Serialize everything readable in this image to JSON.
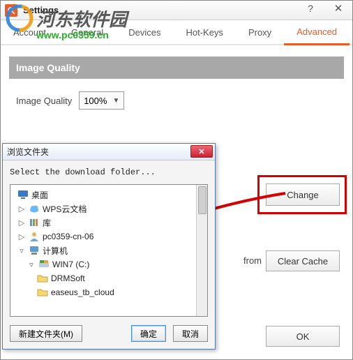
{
  "watermark": {
    "text": "河东软件园",
    "url": "www.pc0359.cn"
  },
  "titlebar": {
    "title": "Settings",
    "help": "?",
    "close": "✕"
  },
  "tabs": {
    "account": "Account",
    "general": "General",
    "devices": "Devices",
    "hotkeys": "Hot-Keys",
    "proxy": "Proxy",
    "advanced": "Advanced"
  },
  "imageQuality": {
    "header": "Image Quality",
    "label": "Image Quality",
    "value": "100%"
  },
  "buttons": {
    "change": "Change",
    "clearCache": "Clear Cache",
    "ok": "OK"
  },
  "fromText": "from",
  "browse": {
    "title": "浏览文件夹",
    "instruction": "Select the download folder...",
    "close": "✕",
    "newFolder": "新建文件夹(M)",
    "ok": "确定",
    "cancel": "取消",
    "tree": {
      "desktop": "桌面",
      "wps": "WPS云文档",
      "libraries": "库",
      "pc": "pc0359-cn-06",
      "computer": "计算机",
      "win7": "WIN7 (C:)",
      "drmsoft": "DRMSoft",
      "easeus": "easeus_tb_cloud"
    }
  }
}
